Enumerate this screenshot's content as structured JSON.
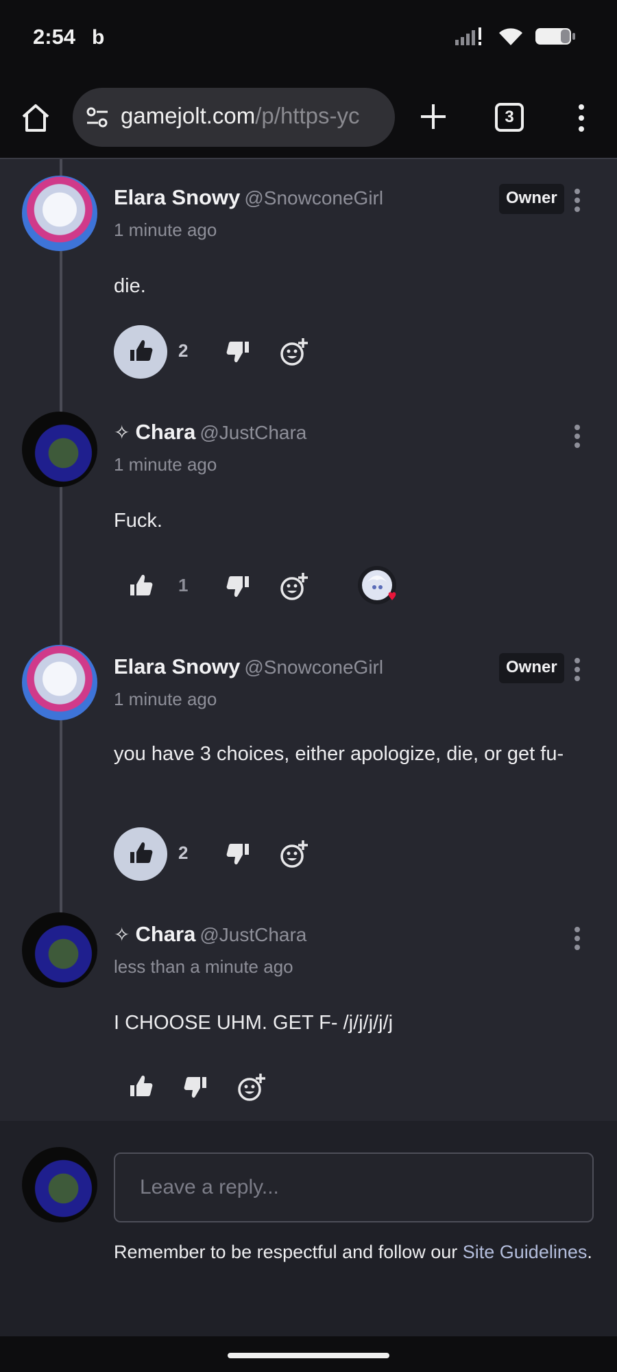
{
  "status_bar": {
    "time": "2:54",
    "app_letter": "b"
  },
  "browser": {
    "url_host": "gamejolt.com",
    "url_path": "/p/https-yc",
    "tab_count": "3"
  },
  "comments": [
    {
      "name": "Elara Snowy",
      "handle": "@SnowconeGirl",
      "time": "1 minute ago",
      "badge": "Owner",
      "text": "die.",
      "likes": "2"
    },
    {
      "name": "Chara",
      "handle": "@JustChara",
      "time": "1 minute ago",
      "text": "Fuck.",
      "likes": "1"
    },
    {
      "name": "Elara Snowy",
      "handle": "@SnowconeGirl",
      "time": "1 minute ago",
      "badge": "Owner",
      "text": "you have 3 choices, either apologize, die, or get fu-",
      "likes": "2"
    },
    {
      "name": "Chara",
      "handle": "@JustChara",
      "time": "less than a minute ago",
      "text": "I CHOOSE UHM. GET F- /j/j/j/j/j"
    }
  ],
  "reply": {
    "placeholder": "Leave a reply...",
    "guidelines_text": "Remember to be respectful and follow our ",
    "guidelines_link": "Site Guidelines",
    "guidelines_end": "."
  }
}
